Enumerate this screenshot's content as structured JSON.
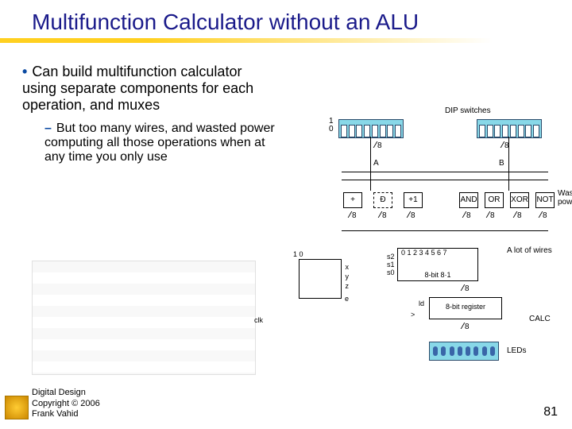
{
  "title": "Multifunction Calculator without an ALU",
  "bullet_main": "Can build multifunction calculator using separate components for each operation, and muxes",
  "bullet_sub": "But too many wires, and wasted power computing all those operations when at any time you only use",
  "diagram": {
    "dip_label": "DIP switches",
    "dip_bits": [
      "1",
      "0"
    ],
    "bus_width": "8",
    "input_a": "A",
    "input_b": "B",
    "ops": {
      "add": "+",
      "sub": "Ð",
      "inc": "+1",
      "and": "AND",
      "or": "OR",
      "xor": "XOR",
      "not": "NOT"
    },
    "wasted": "Wasted power",
    "alot": "A lot of wires",
    "mux": {
      "top": "0 1 2 3 4 5 6 7",
      "side": [
        "s2",
        "s1",
        "s0"
      ],
      "label": "8-bit 8·1"
    },
    "ctrl": {
      "top": "1  0",
      "x": "x",
      "y": "y",
      "z": "z",
      "e": "e"
    },
    "reg": {
      "label": "8-bit register",
      "ld": "ld",
      "clk_sym": ">"
    },
    "clk": "clk",
    "calc": "CALC",
    "leds": "LEDs"
  },
  "footer": {
    "l1": "Digital Design",
    "l2": "Copyright © 2006",
    "l3": "Frank Vahid"
  },
  "page": "81"
}
